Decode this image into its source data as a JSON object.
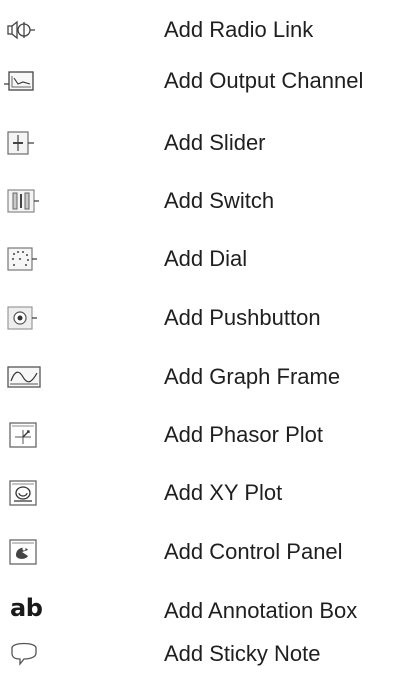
{
  "items": [
    {
      "label": "Add Radio Link",
      "icon": "radio-link-icon"
    },
    {
      "label": "Add Output Channel",
      "icon": "output-channel-icon"
    },
    {
      "label": "Add Slider",
      "icon": "slider-icon"
    },
    {
      "label": "Add Switch",
      "icon": "switch-icon"
    },
    {
      "label": "Add Dial",
      "icon": "dial-icon"
    },
    {
      "label": "Add Pushbutton",
      "icon": "pushbutton-icon"
    },
    {
      "label": "Add Graph Frame",
      "icon": "graph-frame-icon"
    },
    {
      "label": "Add Phasor Plot",
      "icon": "phasor-plot-icon"
    },
    {
      "label": "Add XY Plot",
      "icon": "xy-plot-icon"
    },
    {
      "label": "Add Control Panel",
      "icon": "control-panel-icon"
    },
    {
      "label": "Add Annotation Box",
      "icon": "annotation-box-icon",
      "icon_text": "ab"
    },
    {
      "label": "Add Sticky Note",
      "icon": "sticky-note-icon"
    }
  ]
}
